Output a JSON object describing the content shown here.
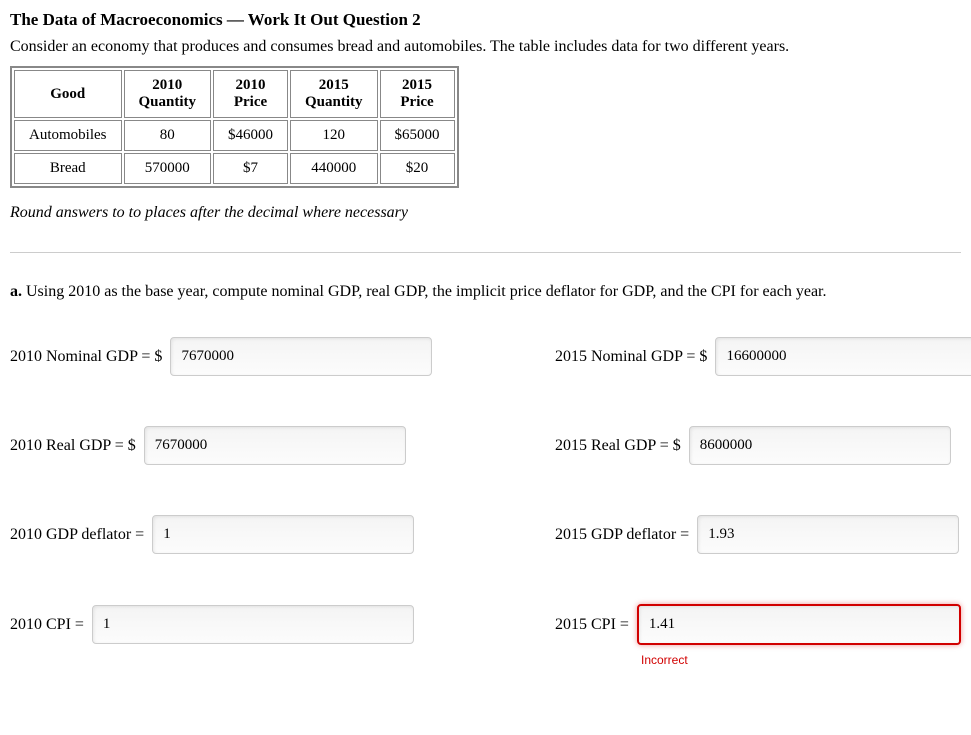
{
  "title": "The Data of Macroeconomics — Work It Out Question 2",
  "intro": "Consider an economy that produces and consumes bread and automobiles. The table includes data for two different years.",
  "table": {
    "headers": {
      "good": "Good",
      "qty2010": "2010 Quantity",
      "price2010": "2010 Price",
      "qty2015": "2015 Quantity",
      "price2015": "2015 Price"
    },
    "rows": [
      {
        "good": "Automobiles",
        "qty2010": "80",
        "price2010": "$46000",
        "qty2015": "120",
        "price2015": "$65000"
      },
      {
        "good": "Bread",
        "qty2010": "570000",
        "price2010": "$7",
        "qty2015": "440000",
        "price2015": "$20"
      }
    ]
  },
  "note": "Round answers to to places after the decimal where necessary",
  "part_a_prefix": "a.",
  "part_a_text": " Using 2010 as the base year, compute nominal GDP, real GDP, the implicit price deflator for GDP, and the CPI for each year.",
  "fields": {
    "nom2010": {
      "label": "2010 Nominal GDP = $",
      "value": "7670000"
    },
    "nom2015": {
      "label": "2015 Nominal GDP = $",
      "value": "16600000"
    },
    "real2010": {
      "label": "2010 Real GDP = $",
      "value": "7670000"
    },
    "real2015": {
      "label": "2015 Real GDP = $",
      "value": "8600000"
    },
    "def2010": {
      "label": "2010 GDP deflator =",
      "value": "1"
    },
    "def2015": {
      "label": "2015 GDP deflator =",
      "value": "1.93"
    },
    "cpi2010": {
      "label": "2010 CPI =",
      "value": "1"
    },
    "cpi2015": {
      "label": "2015 CPI =",
      "value": "1.41",
      "feedback": "Incorrect"
    }
  }
}
